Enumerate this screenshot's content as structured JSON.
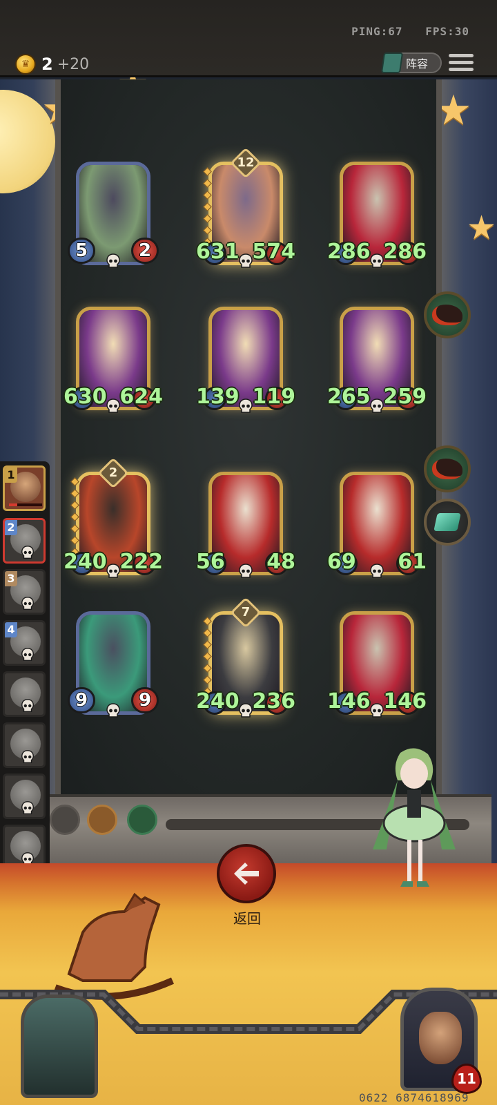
{
  "perf": {
    "ping": "PING:67",
    "fps": "FPS:30"
  },
  "gold": {
    "value": "2",
    "increment": "+20"
  },
  "lineup_button": {
    "label": "阵容"
  },
  "back_button": {
    "label": "返回"
  },
  "uid": "0622 6874618969",
  "hero": {
    "health": "11"
  },
  "colors": {
    "stat_text": "#aef59a",
    "back_button": "#c43a2e",
    "board": "#232827",
    "floor": "#f2c451"
  },
  "minions": [
    {
      "name": "witch",
      "attack": "5",
      "health": "2",
      "style": "plain",
      "tier": ""
    },
    {
      "name": "pirate-brute",
      "attack": "631",
      "health": "574",
      "style": "golden",
      "tier": "12"
    },
    {
      "name": "clown-jack",
      "attack": "286",
      "health": "286",
      "style": "gold",
      "tier": ""
    },
    {
      "name": "horned-banker",
      "attack": "630",
      "health": "624",
      "style": "gold",
      "tier": ""
    },
    {
      "name": "horned-banker",
      "attack": "139",
      "health": "119",
      "style": "gold",
      "tier": ""
    },
    {
      "name": "horned-banker",
      "attack": "265",
      "health": "259",
      "style": "gold",
      "tier": ""
    },
    {
      "name": "hooded-assassin",
      "attack": "240",
      "health": "222",
      "style": "golden",
      "tier": "2"
    },
    {
      "name": "toy-soldier",
      "attack": "56",
      "health": "48",
      "style": "gold",
      "tier": ""
    },
    {
      "name": "toy-soldier",
      "attack": "69",
      "health": "61",
      "style": "gold",
      "tier": ""
    },
    {
      "name": "horned-elf",
      "attack": "9",
      "health": "9",
      "style": "plain",
      "tier": ""
    },
    {
      "name": "armored-knight",
      "attack": "240",
      "health": "236",
      "style": "golden",
      "tier": "7"
    },
    {
      "name": "clown-jack",
      "attack": "146",
      "health": "146",
      "style": "gold",
      "tier": ""
    }
  ],
  "players": [
    {
      "rank": "1",
      "status": "self"
    },
    {
      "rank": "2",
      "status": "opponent"
    },
    {
      "rank": "3",
      "status": "dead"
    },
    {
      "rank": "4",
      "status": "dead"
    },
    {
      "rank": "",
      "status": "dead"
    },
    {
      "rank": "",
      "status": "dead"
    },
    {
      "rank": "",
      "status": "dead"
    },
    {
      "rank": "",
      "status": "dead"
    }
  ],
  "side_buttons": [
    "raven-icon",
    "raven-icon",
    "gem-icon"
  ]
}
